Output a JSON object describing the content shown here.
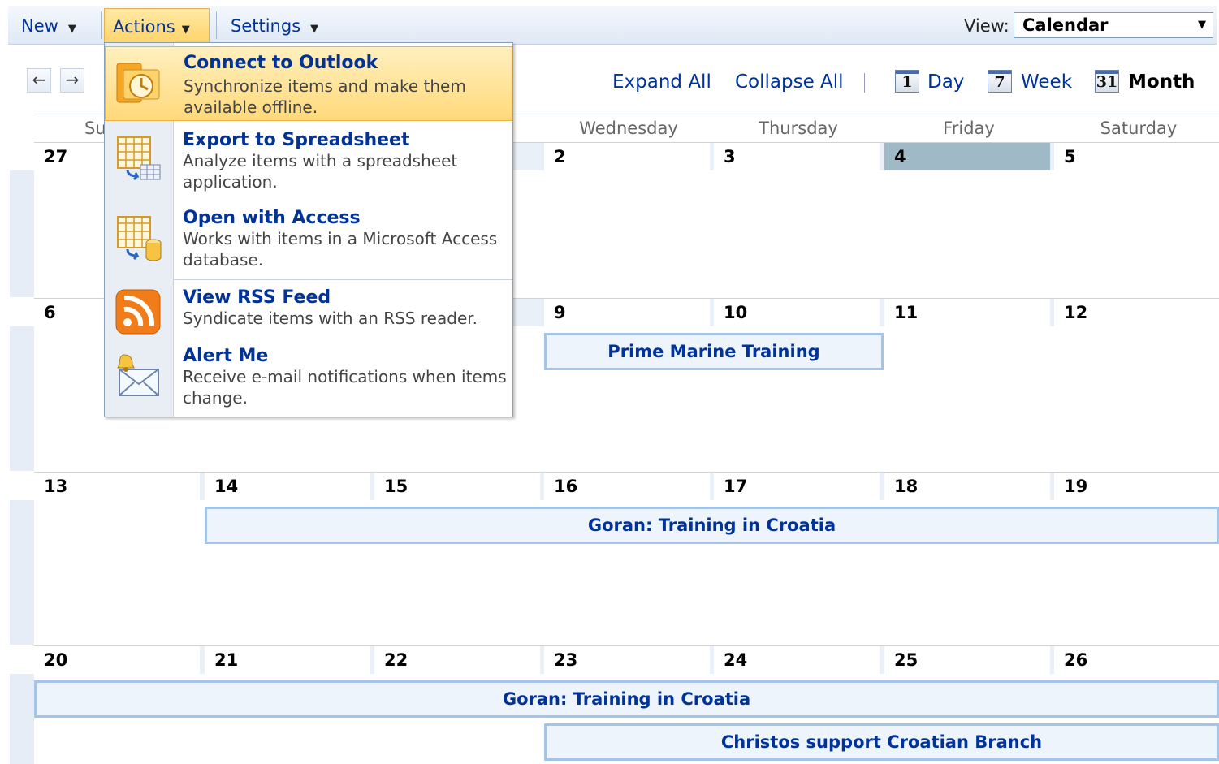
{
  "toolbar": {
    "new_label": "New",
    "actions_label": "Actions",
    "settings_label": "Settings",
    "view_label": "View:",
    "view_value": "Calendar"
  },
  "nav": {
    "prev_glyph": "←",
    "next_glyph": "→",
    "expand_all": "Expand All",
    "collapse_all": "Collapse All",
    "day_icon": "1",
    "day_label": "Day",
    "week_icon": "7",
    "week_label": "Week",
    "month_icon": "31",
    "month_label": "Month"
  },
  "calendar": {
    "day_names": [
      "Su",
      "",
      "",
      "Wednesday",
      "Thursday",
      "Friday",
      "Saturday"
    ],
    "weeks": [
      [
        "27",
        "",
        "",
        "2",
        "3",
        "4",
        "5"
      ],
      [
        "6",
        "",
        "",
        "9",
        "10",
        "11",
        "12"
      ],
      [
        "13",
        "14",
        "15",
        "16",
        "17",
        "18",
        "19"
      ],
      [
        "20",
        "21",
        "22",
        "23",
        "24",
        "25",
        "26"
      ]
    ],
    "today": "4",
    "events": {
      "prime_marine": "Prime Marine Training",
      "goran_1": "Goran: Training in Croatia",
      "goran_2": "Goran: Training in Croatia",
      "christos": "Christos support Croatian Branch"
    }
  },
  "menu": {
    "items": [
      {
        "title": "Connect to Outlook",
        "desc": "Synchronize items and make them available offline.",
        "icon": "outlook-icon"
      },
      {
        "title": "Export to Spreadsheet",
        "desc": "Analyze items with a spreadsheet application.",
        "icon": "spreadsheet-icon"
      },
      {
        "title": "Open with Access",
        "desc": "Works with items in a Microsoft Access database.",
        "icon": "access-icon"
      },
      {
        "title": "View RSS Feed",
        "desc": "Syndicate items with an RSS reader.",
        "icon": "rss-icon"
      },
      {
        "title": "Alert Me",
        "desc": "Receive e-mail notifications when items change.",
        "icon": "alert-icon"
      }
    ]
  },
  "colors": {
    "link": "#003399",
    "menu_highlight": "#ffd97a",
    "today": "#9fb9c6",
    "event_border": "#a4c4e8"
  }
}
